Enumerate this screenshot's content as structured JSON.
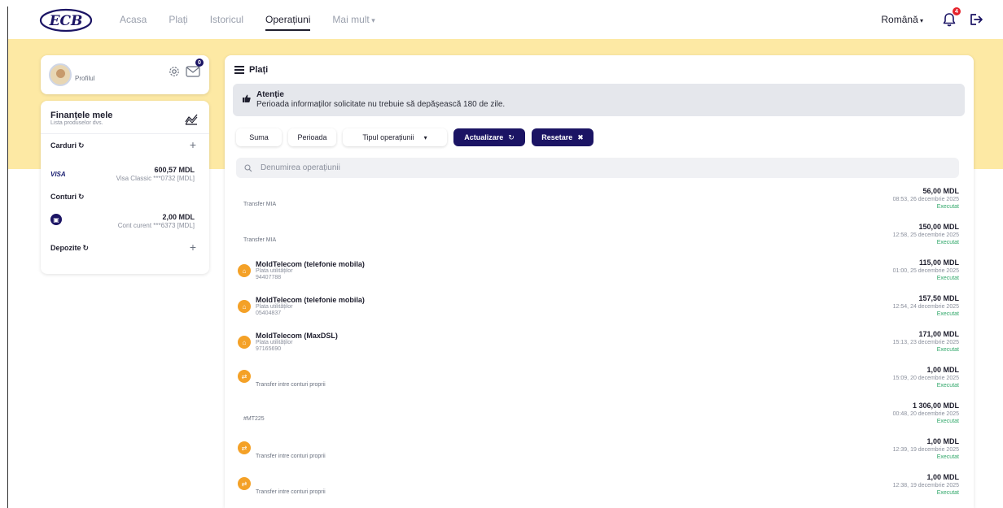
{
  "logo": {
    "text": "ECB"
  },
  "nav": {
    "items": [
      "Acasa",
      "Plați",
      "Istoricul",
      "Operațiuni",
      "Mai mult"
    ],
    "active": "Operațiuni"
  },
  "header": {
    "language": "Română",
    "notifications_count": "4",
    "icons": [
      "bell-icon",
      "logout-icon"
    ]
  },
  "profile": {
    "label": "Profilul",
    "messages_count": "0",
    "icons": [
      "gear-icon",
      "mail-icon"
    ]
  },
  "finances": {
    "title": "Finanțele mele",
    "subtitle": "Lista produselor dvs.",
    "cards_label": "Carduri",
    "card": {
      "brand": "VISA",
      "amount": "600,57 MDL",
      "desc": "Visa Classic ***0732 [MDL]"
    },
    "accounts_label": "Conturi",
    "account": {
      "amount": "2,00 MDL",
      "desc": "Cont curent ***6373 [MDL]"
    },
    "deposits_label": "Depozite"
  },
  "main": {
    "title": "Plați",
    "alert": {
      "title": "Atenție",
      "text": "Perioada informaților solicitate nu trebuie să depășească 180 de zile."
    },
    "filters": {
      "suma": "Suma",
      "perioada": "Perioada",
      "tip": "Tipul operațiunii",
      "actualizare": "Actualizare",
      "resetare": "Resetare"
    },
    "search_placeholder": "Denumirea operațiunii",
    "transactions": [
      {
        "title": "",
        "subtitle": "",
        "code": "",
        "plain": "Transfer MIA",
        "icon": "",
        "amount": "56,00 MDL",
        "date": "08:53, 26 decembrie 2025",
        "status": "Executat"
      },
      {
        "title": "",
        "subtitle": "",
        "code": "",
        "plain": "Transfer MIA",
        "icon": "",
        "amount": "150,00 MDL",
        "date": "12:58, 25 decembrie 2025",
        "status": "Executat"
      },
      {
        "title": "MoldTelecom (telefonie mobila)",
        "subtitle": "Plata utilităților",
        "code": "94407788",
        "plain": "",
        "icon": "home-icon",
        "amount": "115,00 MDL",
        "date": "01:00, 25 decembrie 2025",
        "status": "Executat"
      },
      {
        "title": "MoldTelecom (telefonie mobila)",
        "subtitle": "Plata utilităților",
        "code": "05404837",
        "plain": "",
        "icon": "home-icon",
        "amount": "157,50 MDL",
        "date": "12:54, 24 decembrie 2025",
        "status": "Executat"
      },
      {
        "title": "MoldTelecom (MaxDSL)",
        "subtitle": "Plata utilităților",
        "code": "97165690",
        "plain": "",
        "icon": "home-icon",
        "amount": "171,00 MDL",
        "date": "15:13, 23 decembrie 2025",
        "status": "Executat"
      },
      {
        "title": "",
        "subtitle": "",
        "code": "",
        "plain": "Transfer intre conturi proprii",
        "icon": "transfer-icon",
        "amount": "1,00 MDL",
        "date": "15:09, 20 decembrie 2025",
        "status": "Executat"
      },
      {
        "title": "",
        "subtitle": "",
        "code": "",
        "plain": "#MT225",
        "icon": "",
        "amount": "1 306,00 MDL",
        "date": "00:48, 20 decembrie 2025",
        "status": "Executat"
      },
      {
        "title": "",
        "subtitle": "",
        "code": "",
        "plain": "Transfer intre conturi proprii",
        "icon": "transfer-icon",
        "amount": "1,00 MDL",
        "date": "12:39, 19 decembrie 2025",
        "status": "Executat"
      },
      {
        "title": "",
        "subtitle": "",
        "code": "",
        "plain": "Transfer intre conturi proprii",
        "icon": "transfer-icon",
        "amount": "1,00 MDL",
        "date": "12:38, 19 decembrie 2025",
        "status": "Executat"
      }
    ]
  },
  "colors": {
    "brand_dark": "#1b1464",
    "band_yellow": "#fde9a4",
    "accent_orange": "#f4a127",
    "status_green": "#32a86b",
    "badge_red": "#e5222b"
  }
}
